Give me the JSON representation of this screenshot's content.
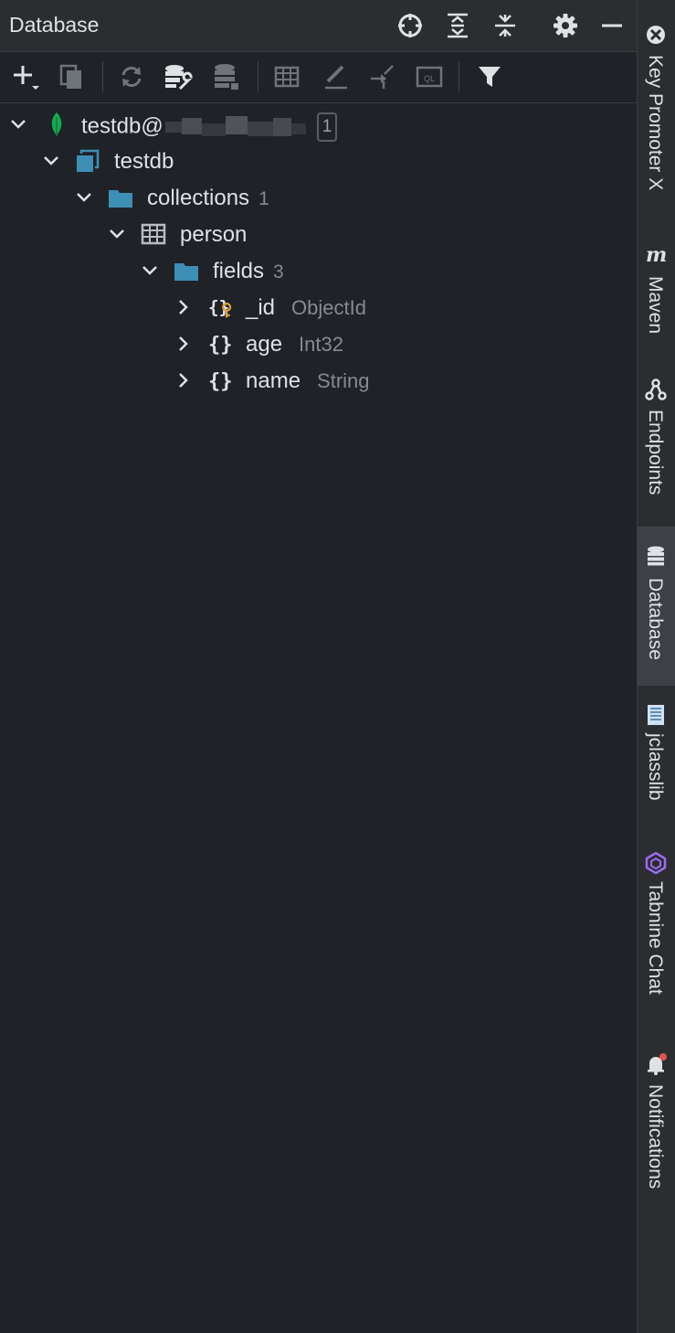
{
  "header": {
    "title": "Database",
    "buttons": [
      "locate-icon",
      "expand-all-icon",
      "collapse-all-icon",
      "gear-icon",
      "minimize-icon"
    ]
  },
  "toolbar": {
    "buttons": [
      "add-icon",
      "duplicate-icon",
      "refresh-icon",
      "data-source-properties-icon",
      "database-icon",
      "table-icon",
      "edit-icon",
      "jump-icon",
      "query-console-icon",
      "filter-icon"
    ]
  },
  "tree": {
    "datasource": {
      "label": "testdb@",
      "badge": "1"
    },
    "database": {
      "label": "testdb"
    },
    "collections": {
      "label": "collections",
      "count": "1"
    },
    "table": {
      "label": "person"
    },
    "fields": {
      "label": "fields",
      "count": "3"
    },
    "field_items": [
      {
        "label": "_id",
        "type": "ObjectId"
      },
      {
        "label": "age",
        "type": "Int32"
      },
      {
        "label": "name",
        "type": "String"
      }
    ]
  },
  "rightbar": {
    "tabs": [
      {
        "label": "Key Promoter X"
      },
      {
        "label": "Maven"
      },
      {
        "label": "Endpoints"
      },
      {
        "label": "Database"
      },
      {
        "label": "jclasslib"
      },
      {
        "label": "Tabnine Chat"
      },
      {
        "label": "Notifications"
      }
    ]
  },
  "colors": {
    "background": "#1f2227",
    "header": "#2b2d30",
    "folder": "#3d8fb5",
    "mongo_leaf": "#13aa52",
    "key": "#e0a43b",
    "muted_text": "#868a91",
    "notification_dot": "#e55353",
    "tabnine": "#9b6cf0"
  }
}
